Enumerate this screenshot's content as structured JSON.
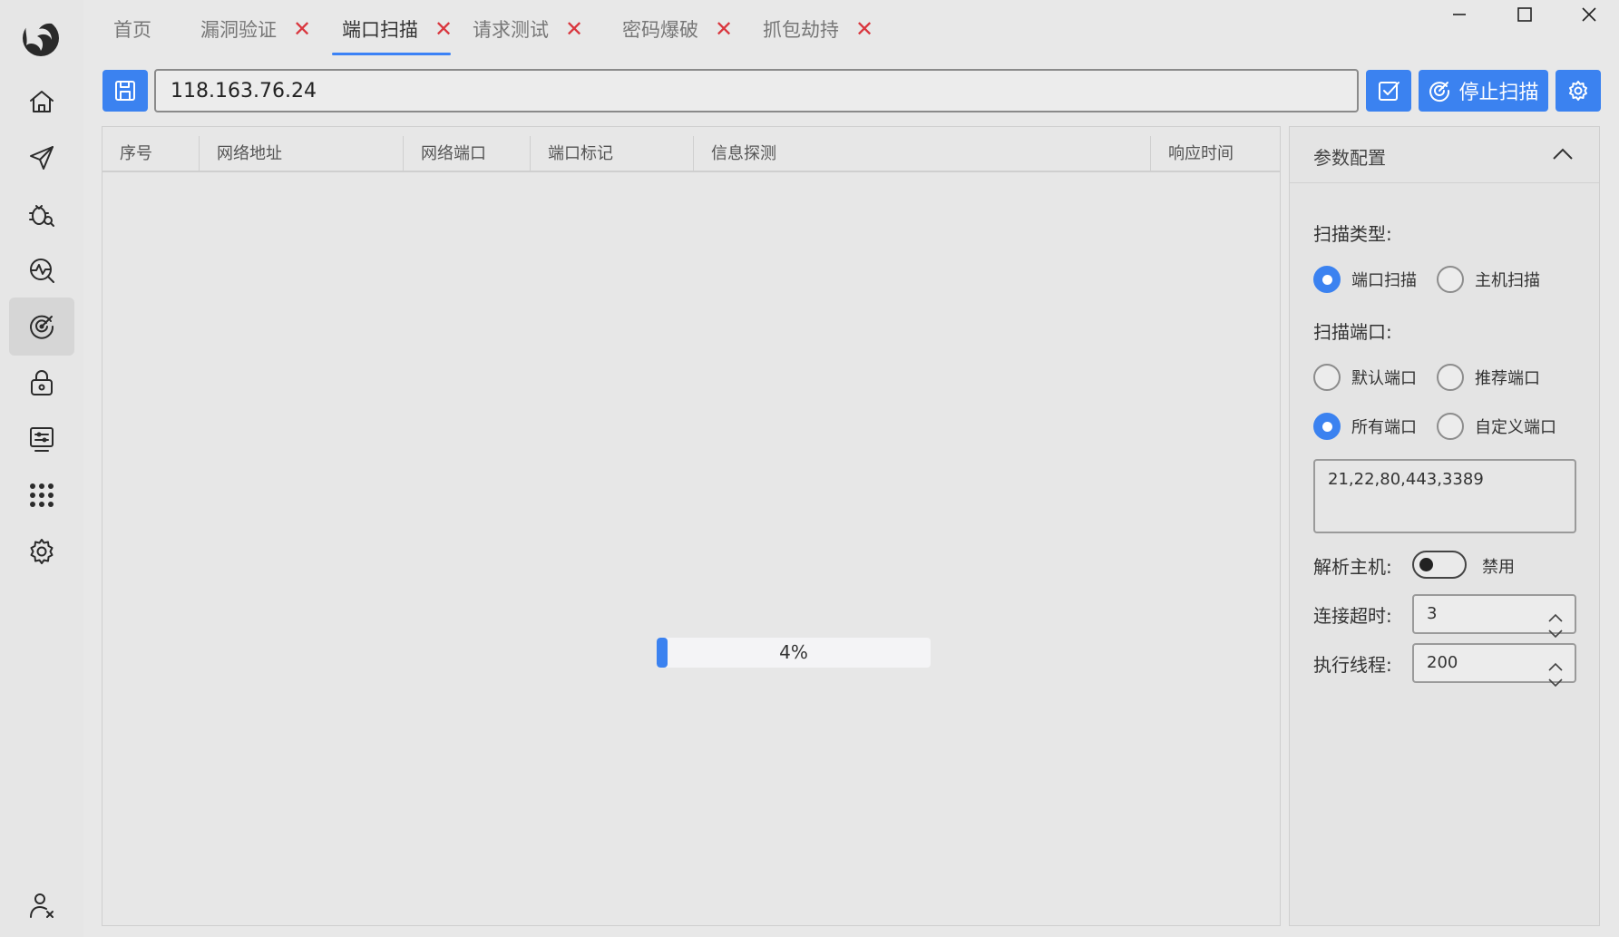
{
  "tabs": [
    {
      "label": "首页",
      "closable": false
    },
    {
      "label": "漏洞验证",
      "closable": true
    },
    {
      "label": "端口扫描",
      "closable": true,
      "active": true
    },
    {
      "label": "请求测试",
      "closable": true
    },
    {
      "label": "密码爆破",
      "closable": true
    },
    {
      "label": "抓包劫持",
      "closable": true
    }
  ],
  "close_glyph": "✕",
  "toolbar": {
    "target": "118.163.76.24",
    "stop_label": "停止扫描"
  },
  "table": {
    "columns": [
      "序号",
      "网络地址",
      "网络端口",
      "端口标记",
      "信息探测",
      "响应时间"
    ],
    "rows": []
  },
  "progress": {
    "value": 4,
    "label": "4%"
  },
  "config": {
    "title": "参数配置",
    "scan_type_label": "扫描类型:",
    "scan_types": [
      {
        "label": "端口扫描",
        "selected": true
      },
      {
        "label": "主机扫描",
        "selected": false
      }
    ],
    "scan_ports_label": "扫描端口:",
    "port_options": [
      {
        "label": "默认端口",
        "selected": false
      },
      {
        "label": "推荐端口",
        "selected": false
      },
      {
        "label": "所有端口",
        "selected": true
      },
      {
        "label": "自定义端口",
        "selected": false
      }
    ],
    "custom_ports": "21,22,80,443,3389",
    "resolve_host_label": "解析主机:",
    "resolve_host_state": "禁用",
    "timeout_label": "连接超时:",
    "timeout_value": "3",
    "threads_label": "执行线程:",
    "threads_value": "200"
  },
  "colors": {
    "accent": "#3b82f0",
    "close": "#d9363e"
  },
  "icons": [
    "app-logo-icon",
    "home-icon",
    "send-icon",
    "bug-search-icon",
    "activity-search-icon",
    "radar-icon",
    "lock-icon",
    "monitor-icon",
    "apps-grid-icon",
    "settings-icon",
    "user-x-icon"
  ]
}
